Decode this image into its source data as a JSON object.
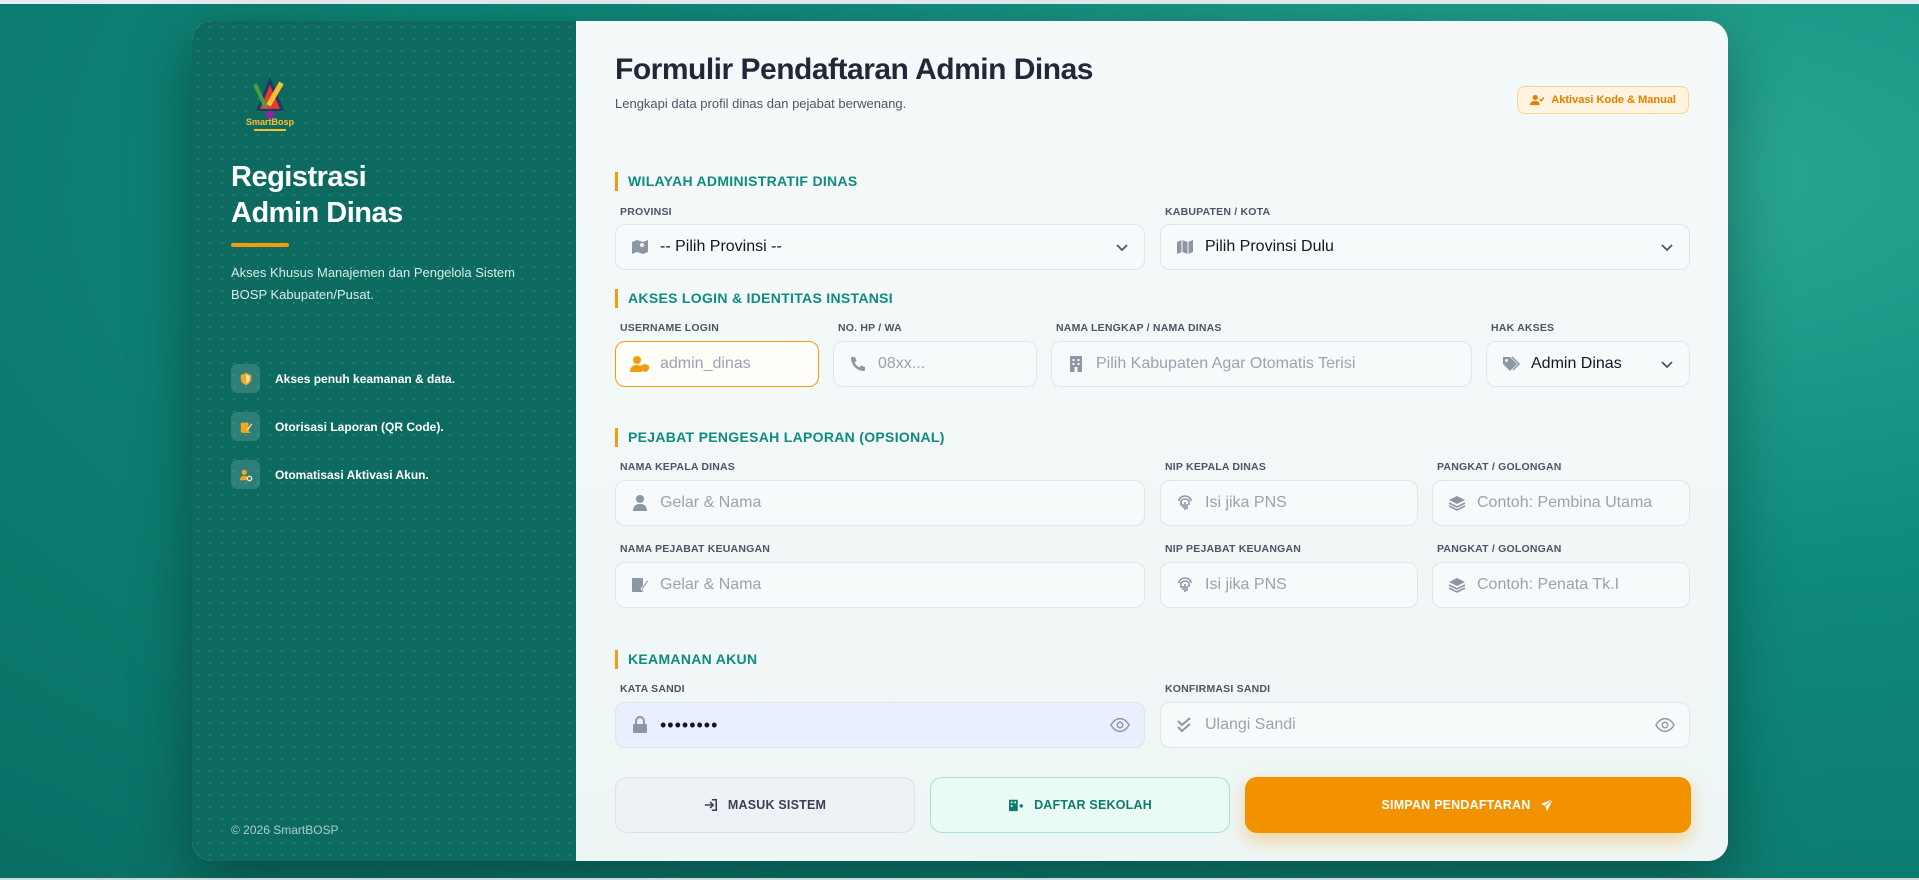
{
  "sidebar": {
    "logo_text": "SmartBosp",
    "title_line1": "Registrasi",
    "title_line2": "Admin Dinas",
    "description": "Akses Khusus Manajemen dan Pengelola Sistem BOSP Kabupaten/Pusat.",
    "features": [
      {
        "label": "Akses penuh keamanan & data.",
        "icon": "shield-icon"
      },
      {
        "label": "Otorisasi Laporan (QR Code).",
        "icon": "signature-icon"
      },
      {
        "label": "Otomatisasi Aktivasi Akun.",
        "icon": "user-gear-icon"
      }
    ],
    "copyright": "© 2026 SmartBOSP"
  },
  "header": {
    "title": "Formulir Pendaftaran Admin Dinas",
    "subtitle": "Lengkapi data profil dinas dan pejabat berwenang.",
    "badge_label": "Aktivasi Kode & Manual"
  },
  "sections": {
    "wilayah": "WILAYAH ADMINISTRATIF DINAS",
    "akses": "AKSES LOGIN & IDENTITAS INSTANSI",
    "pejabat": "PEJABAT PENGESAH LAPORAN (OPSIONAL)",
    "keamanan": "KEAMANAN AKUN"
  },
  "fields": {
    "provinsi": {
      "label": "PROVINSI",
      "value": "-- Pilih Provinsi --"
    },
    "kabupaten": {
      "label": "KABUPATEN / KOTA",
      "value": "Pilih Provinsi Dulu"
    },
    "username": {
      "label": "USERNAME LOGIN",
      "placeholder": "admin_dinas"
    },
    "hp": {
      "label": "NO. HP / WA",
      "placeholder": "08xx..."
    },
    "nama_dinas": {
      "label": "NAMA LENGKAP / NAMA DINAS",
      "placeholder": "Pilih Kabupaten Agar Otomatis Terisi"
    },
    "hak_akses": {
      "label": "HAK AKSES",
      "value": "Admin Dinas"
    },
    "kepala_nama": {
      "label": "NAMA KEPALA DINAS",
      "placeholder": "Gelar & Nama"
    },
    "kepala_nip": {
      "label": "NIP KEPALA DINAS",
      "placeholder": "Isi jika PNS"
    },
    "kepala_pangkat": {
      "label": "PANGKAT / GOLONGAN",
      "placeholder": "Contoh: Pembina Utama"
    },
    "keu_nama": {
      "label": "NAMA PEJABAT KEUANGAN",
      "placeholder": "Gelar & Nama"
    },
    "keu_nip": {
      "label": "NIP PEJABAT KEUANGAN",
      "placeholder": "Isi jika PNS"
    },
    "keu_pangkat": {
      "label": "PANGKAT / GOLONGAN",
      "placeholder": "Contoh: Penata Tk.I"
    },
    "sandi": {
      "label": "KATA SANDI",
      "value": "••••••••"
    },
    "konfirmasi": {
      "label": "KONFIRMASI SANDI",
      "placeholder": "Ulangi Sandi"
    }
  },
  "buttons": {
    "login": "MASUK SISTEM",
    "school": "DAFTAR SEKOLAH",
    "save": "SIMPAN PENDAFTARAN"
  },
  "colors": {
    "accent": "#f39200",
    "teal": "#0f8b7f",
    "sidebar_bg": "#0c6a61"
  }
}
